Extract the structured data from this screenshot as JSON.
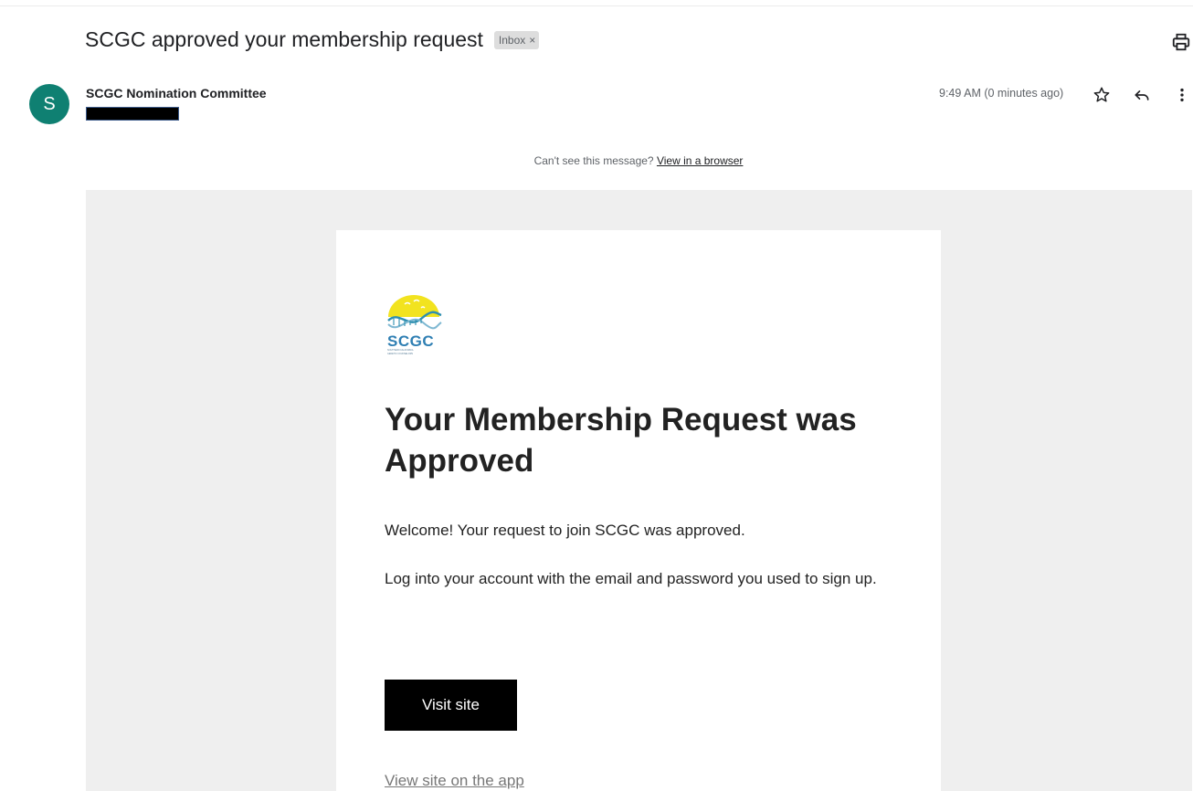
{
  "email": {
    "subject": "SCGC approved your membership request",
    "label": "Inbox",
    "label_remove": "×"
  },
  "sender": {
    "name": "SCGC Nomination Committee",
    "avatar_letter": "S",
    "avatar_color": "#0f8072",
    "timestamp": "9:49 AM (0 minutes ago)"
  },
  "icons": {
    "print": "print-icon",
    "star": "star-icon",
    "reply": "reply-icon",
    "more": "more-vert-icon"
  },
  "preview_notice": {
    "text": "Can't see this message?",
    "link": "View in a browser"
  },
  "message": {
    "logo_text": "SCGC",
    "logo_subtext": "SOUTHERN CALIFORNIA GENETIC COUNSELORS",
    "headline": "Your Membership Request was Approved",
    "paragraph_1": "Welcome! Your request to join SCGC was approved.",
    "paragraph_2": "Log into your account with the email and password you used to sign up.",
    "button_label": "Visit site",
    "app_link": "View site on the app"
  }
}
